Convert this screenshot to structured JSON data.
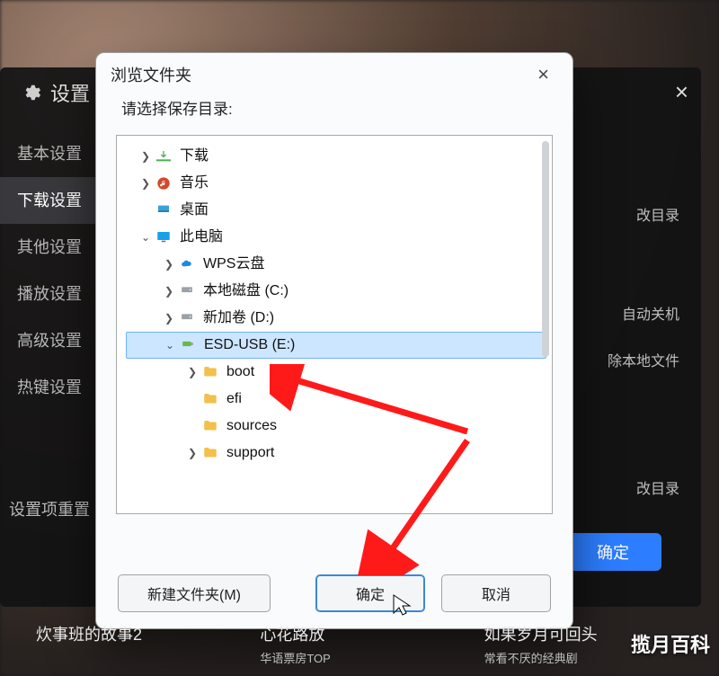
{
  "settings": {
    "title": "设置",
    "close": "×",
    "side_items": [
      "基本设置",
      "下载设置",
      "其他设置",
      "播放设置",
      "高级设置",
      "热键设置",
      "设置项重置"
    ],
    "side_active_index": 1,
    "right_items": [
      "改目录",
      "自动关机",
      "除本地文件",
      "改目录"
    ],
    "primary_button": "确定"
  },
  "dialog": {
    "title": "浏览文件夹",
    "close": "×",
    "instruction": "请选择保存目录:",
    "new_folder_button": "新建文件夹(M)",
    "ok_button": "确定",
    "cancel_button": "取消",
    "tree": [
      {
        "depth": 1,
        "twisty": ">",
        "icon": "dl",
        "label": "下载"
      },
      {
        "depth": 1,
        "twisty": ">",
        "icon": "music",
        "label": "音乐"
      },
      {
        "depth": 1,
        "twisty": "",
        "icon": "desktop",
        "label": "桌面"
      },
      {
        "depth": 1,
        "twisty": "v",
        "icon": "monitor",
        "label": "此电脑"
      },
      {
        "depth": 2,
        "twisty": ">",
        "icon": "cloud",
        "label": "WPS云盘"
      },
      {
        "depth": 2,
        "twisty": ">",
        "icon": "disk",
        "label": "本地磁盘 (C:)"
      },
      {
        "depth": 2,
        "twisty": ">",
        "icon": "disk",
        "label": "新加卷 (D:)"
      },
      {
        "depth": 2,
        "twisty": "v",
        "icon": "usb",
        "label": "ESD-USB (E:)",
        "selected": true
      },
      {
        "depth": 3,
        "twisty": ">",
        "icon": "folder",
        "label": "boot"
      },
      {
        "depth": 3,
        "twisty": "",
        "icon": "folder",
        "label": "efi"
      },
      {
        "depth": 3,
        "twisty": "",
        "icon": "folder",
        "label": "sources"
      },
      {
        "depth": 3,
        "twisty": ">",
        "icon": "folder",
        "label": "support"
      }
    ]
  },
  "strip": {
    "items": [
      {
        "title": "炊事班的故事2",
        "sub": ""
      },
      {
        "title": "心花路放",
        "sub": "华语票房TOP"
      },
      {
        "title": "如果岁月可回头",
        "sub": "常看不厌的经典剧"
      }
    ]
  },
  "watermark": "揽月百科"
}
